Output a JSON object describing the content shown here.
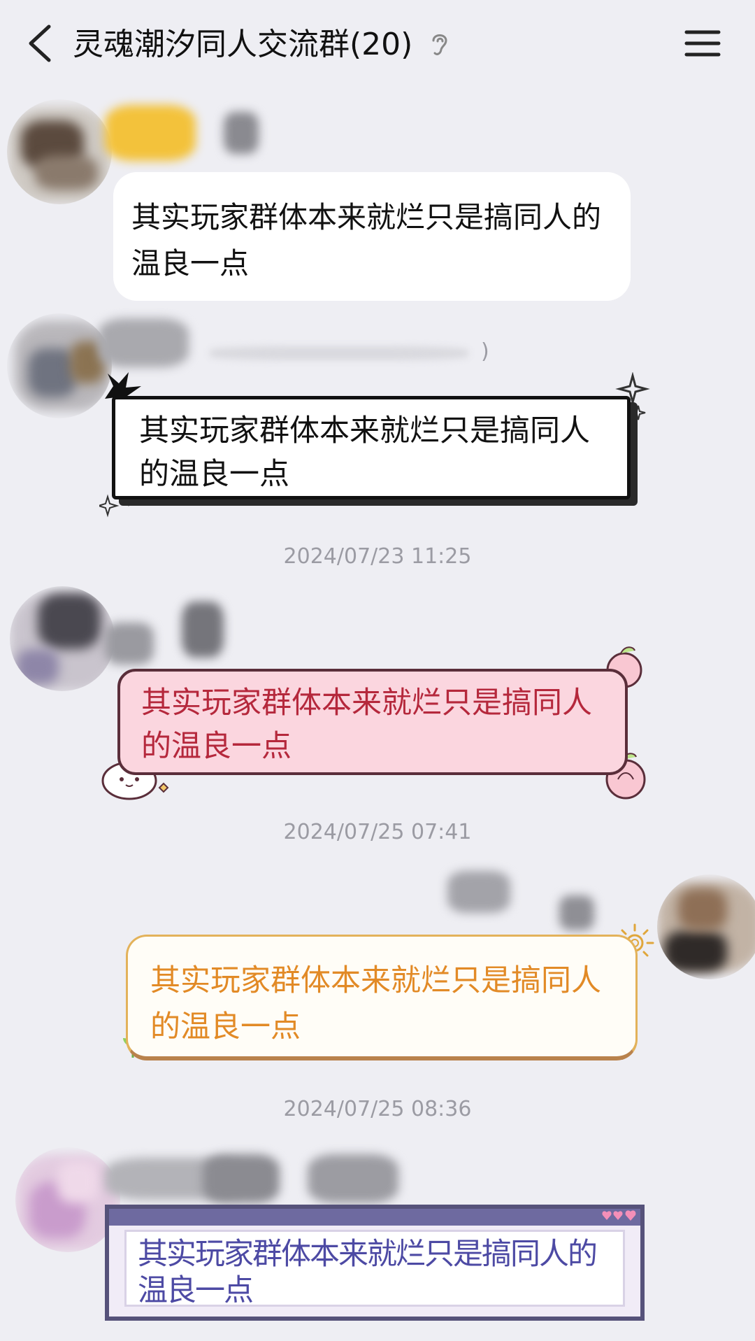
{
  "header": {
    "title": "灵魂潮汐同人交流群(20)"
  },
  "messages": [
    {
      "text": "其实玩家群体本来就烂只是搞同人的温良一点"
    },
    {
      "text": "其实玩家群体本来就烂只是搞同人的温良一点"
    },
    {
      "text": "其实玩家群体本来就烂只是搞同人的温良一点"
    },
    {
      "text": "其实玩家群体本来就烂只是搞同人的温良一点"
    },
    {
      "text": "其实玩家群体本来就烂只是搞同人的温良一点"
    }
  ],
  "timestamps": [
    "2024/07/23 11:25",
    "2024/07/25 07:41",
    "2024/07/25 08:36"
  ],
  "partial_text": ")",
  "icons": {
    "back": "back-arrow-icon",
    "listen": "ear-icon",
    "menu": "hamburger-menu-icon"
  },
  "colors": {
    "background": "#eeeef3",
    "timestamp": "#9b9ba3",
    "pink_text": "#b5283c",
    "orange_text": "#e28a26",
    "purple_text": "#4d4aa4"
  }
}
